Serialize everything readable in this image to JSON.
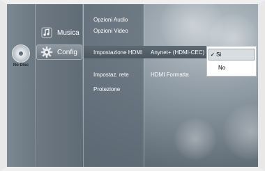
{
  "disc_status": {
    "label": "No Disc"
  },
  "main_menu": {
    "items": [
      {
        "label": "Musica",
        "icon": "music-note-icon",
        "selected": false
      },
      {
        "label": "Config",
        "icon": "gear-icon",
        "selected": true
      }
    ]
  },
  "setup_menu": {
    "items": [
      {
        "label": "Opzioni Audio"
      },
      {
        "label": "Opzioni Video"
      },
      {
        "label": "Impostazione HDMI",
        "selected": true
      },
      {
        "label": "Impostaz. rete"
      },
      {
        "label": "Protezione"
      }
    ]
  },
  "hdmi_menu": {
    "items": [
      {
        "label": "Anynet+ (HDMI-CEC)",
        "selected": true
      },
      {
        "label": "HDMI Formatta"
      }
    ]
  },
  "popup": {
    "options": [
      {
        "label": "Si",
        "selected": true,
        "check": "✓"
      },
      {
        "label": "No",
        "selected": false
      }
    ]
  },
  "colors": {
    "frame": "#e8e8e8",
    "highlight": "#4a5660",
    "popup_bg": "#ffffff"
  }
}
